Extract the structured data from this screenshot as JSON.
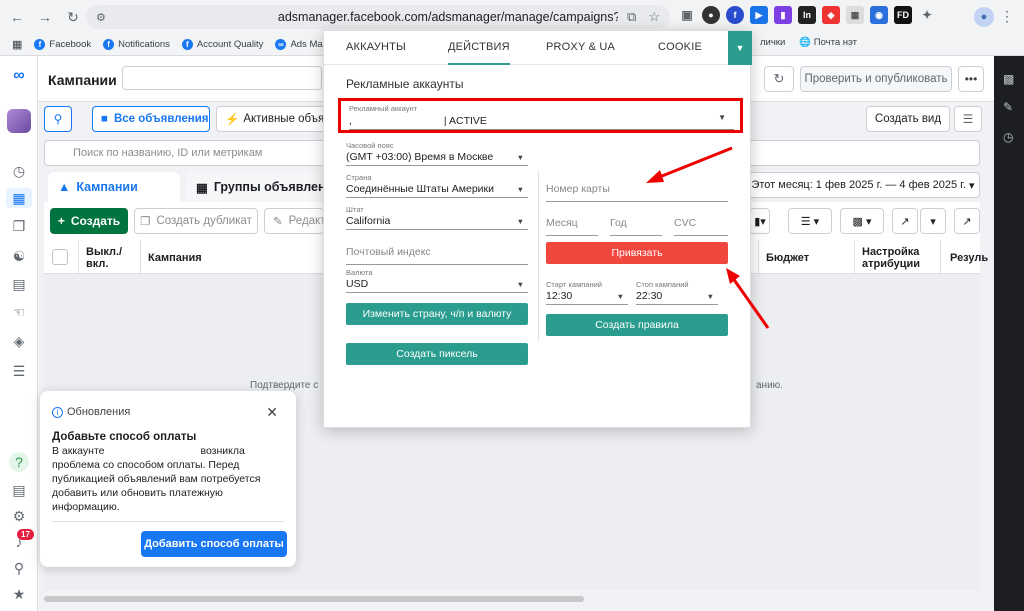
{
  "browser": {
    "url": "adsmanager.facebook.com/adsmanager/manage/campaigns?act=100...",
    "bookmarks": [
      "Facebook",
      "Notifications",
      "Account Quality",
      "Ads Ma"
    ],
    "bookmarks_right": [
      "лички",
      "Почта нэт"
    ]
  },
  "header": {
    "title": "Кампании",
    "publish_label": "Проверить и опубликовать",
    "more_label": "•••"
  },
  "filters": {
    "all_ads": "Все объявления",
    "active_ads": "Активные объявле",
    "create_view": "Создать вид",
    "search_placeholder": "Поиск по названию, ID или метрикам"
  },
  "level_tabs": {
    "campaigns": "Кампании",
    "ad_groups": "Группы объявлении"
  },
  "date_range": "Этот месяц: 1 фев 2025 г. — 4 фев 2025 г.",
  "toolbar": {
    "create": "Создать",
    "duplicate": "Создать дубликат",
    "edit": "Редакт"
  },
  "table": {
    "columns": {
      "toggle": "Выкл./ вкл.",
      "campaign": "Кампания",
      "budget": "Бюджет",
      "attribution": "Настройка атрибуции",
      "results": "Резуль"
    },
    "empty_left": "Подтвердите с",
    "empty_right": "анию."
  },
  "updates_card": {
    "header": "Обновления",
    "title": "Добавьте способ оплаты",
    "body_prefix": "В аккаунте",
    "body_suffix": "возникла проблема со способом оплаты. Перед публикацией объявлений вам потребуется добавить или обновить платежную информацию.",
    "button": "Добавить способ оплаты"
  },
  "sidebar": {
    "notification_count": "17"
  },
  "popup": {
    "tabs": [
      "АККАУНТЫ",
      "ДЕЙСТВИЯ",
      "PROXY & UA",
      "COOKIE"
    ],
    "active_tab": "ДЕЙСТВИЯ",
    "section_title": "Рекламные аккаунты",
    "account": {
      "label": "Рекламный аккаунт",
      "prefix": ",",
      "status": "| ACTIVE"
    },
    "timezone": {
      "label": "Часовой пояс",
      "value": "(GMT +03:00) Время в Москве"
    },
    "country": {
      "label": "Страна",
      "value": "Соединённые Штаты Америки"
    },
    "state": {
      "label": "Штат",
      "value": "California"
    },
    "postal": {
      "placeholder": "Почтовый индекс"
    },
    "currency": {
      "label": "Валюта",
      "value": "USD"
    },
    "change_btn": "Изменить страну, ч/п и валюту",
    "pixel_btn": "Создать пиксель",
    "card": {
      "number_placeholder": "Номер карты",
      "month_placeholder": "Месяц",
      "year_placeholder": "Год",
      "cvc_placeholder": "CVC",
      "link_btn": "Привязать"
    },
    "rules": {
      "start_label": "Старт кампаний",
      "start_value": "12:30",
      "stop_label": "Стоп кампаний",
      "stop_value": "22:30",
      "create_btn": "Создать правила"
    }
  },
  "colors": {
    "accent_blue": "#1877f2",
    "teal": "#2a9d8f",
    "red_button": "#f2473f",
    "highlight_red": "#e00000",
    "create_green": "#00733e"
  }
}
